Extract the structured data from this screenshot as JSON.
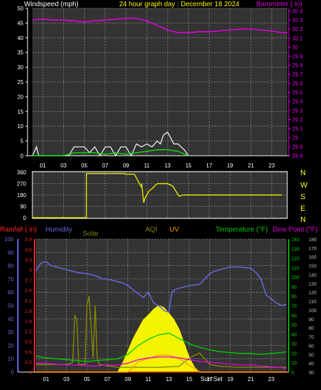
{
  "header": {
    "title": "24 hour graph day : December 18 2024",
    "left_label": "Windspeed (mph)",
    "right_label": "Barometer ( in)"
  },
  "colors": {
    "background": "#000000",
    "plot_background": "#333333",
    "grid": "#8a8a8a",
    "title": "#ffff00",
    "barometer": "#e000e0",
    "wind_gust": "#ffffff",
    "wind_avg": "#00ff00",
    "direction": "#e8e800",
    "rain": "#ff2222",
    "humidity": "#6666dd",
    "solar": "#808000",
    "solar_fill": "#ffff00",
    "aqi": "#888800",
    "uv": "#ff9900",
    "temperature": "#00cc00",
    "dewpoint": "#dd00dd"
  },
  "chart_data": [
    {
      "name": "wind-barometer",
      "type": "line",
      "xlabel": "",
      "x_ticks": [
        "01",
        "03",
        "05",
        "07",
        "09",
        "11",
        "13",
        "15",
        "17",
        "19",
        "21",
        "23"
      ],
      "xlim": [
        0,
        24.5
      ],
      "left_axis": {
        "label": "Windspeed (mph)",
        "ticks": [
          0,
          5,
          10,
          15,
          20,
          25,
          30,
          35,
          40,
          45,
          50
        ],
        "lim": [
          0,
          50
        ]
      },
      "right_axis": {
        "label": "Barometer ( in)",
        "ticks": [
          "28.8",
          "28.9",
          "29",
          "29.1",
          "29.2",
          "29.3",
          "29.4",
          "29.5",
          "29.6",
          "29.7",
          "29.8",
          "29.9",
          "30",
          "30.1",
          "30.2",
          "30.3",
          "30.4"
        ],
        "lim": [
          28.8,
          30.43
        ]
      },
      "series": [
        {
          "name": "Barometer",
          "axis": "right",
          "color": "#e000e0",
          "x": [
            0,
            1,
            2,
            3,
            4,
            5,
            6,
            7,
            8,
            9,
            10,
            11,
            12,
            13,
            14,
            15,
            16,
            17,
            18,
            19,
            20,
            21,
            22,
            23,
            24,
            24.5
          ],
          "y": [
            30.3,
            30.31,
            30.3,
            30.3,
            30.29,
            30.28,
            30.29,
            30.3,
            30.31,
            30.32,
            30.32,
            30.29,
            30.24,
            30.19,
            30.16,
            30.16,
            30.17,
            30.17,
            30.18,
            30.19,
            30.2,
            30.2,
            30.19,
            30.18,
            30.16,
            30.16
          ]
        },
        {
          "name": "Wind gust",
          "axis": "left",
          "color": "#ffffff",
          "x": [
            0,
            0.4,
            0.6,
            0.8,
            1.2,
            2,
            3,
            3.5,
            4,
            4.5,
            5,
            5.5,
            6,
            6.5,
            7,
            7.5,
            8,
            8.5,
            9,
            9.5,
            10,
            10.5,
            11,
            11.5,
            12,
            12.3,
            12.6,
            13,
            13.3,
            13.6,
            14,
            14.3,
            14.6,
            15
          ],
          "y": [
            0,
            3,
            0,
            0,
            0,
            0,
            0,
            0,
            3,
            3,
            3,
            1,
            3,
            0,
            3,
            3,
            0,
            3,
            3,
            0,
            4,
            3,
            4,
            3,
            5,
            4,
            7,
            8,
            6,
            4,
            4,
            3,
            2,
            0
          ]
        },
        {
          "name": "Wind avg",
          "axis": "left",
          "color": "#00ff00",
          "x": [
            0,
            1,
            2,
            3,
            4,
            5,
            6,
            7,
            8,
            9,
            10,
            11,
            12,
            13,
            14,
            15
          ],
          "y": [
            0,
            0,
            0,
            0,
            1,
            1,
            1,
            0.5,
            1,
            0.5,
            1,
            1.5,
            2,
            2,
            1.5,
            0
          ]
        }
      ]
    },
    {
      "name": "wind-direction",
      "type": "line",
      "left_axis": {
        "ticks": [
          0,
          90,
          180,
          270,
          360
        ],
        "lim": [
          0,
          360
        ]
      },
      "right_labels": [
        "N",
        "W",
        "S",
        "E",
        "N"
      ],
      "series": [
        {
          "name": "Wind direction",
          "color": "#e8e800",
          "x": [
            0,
            5.2,
            5.2,
            7,
            8,
            8.8,
            9,
            9.8,
            10.5,
            10.5,
            10.7,
            10.8,
            11.2,
            11.5,
            12,
            13,
            13.5,
            14.1,
            14.5,
            15,
            18,
            24
          ],
          "y": [
            0,
            0,
            350,
            350,
            350,
            350,
            345,
            345,
            240,
            270,
            120,
            150,
            210,
            230,
            270,
            270,
            250,
            170,
            180,
            180,
            180,
            180
          ]
        }
      ]
    },
    {
      "name": "weather-multi",
      "type": "line",
      "x_ticks": [
        "01",
        "03",
        "05",
        "07",
        "09",
        "11",
        "13",
        "15",
        "17",
        "19",
        "21",
        "23"
      ],
      "legend": {
        "rain": "Rainfall ( in)",
        "humidity": "Humidity",
        "solar": "Solar",
        "aqi": "AQI",
        "uv": "UV",
        "temperature": "Temperature (°F)",
        "dewpoint": "Dew Point (°F)"
      },
      "annotations": [
        "Sun Set"
      ],
      "humidity_axis": {
        "ticks": [
          0,
          10,
          20,
          30,
          40,
          50,
          60,
          70,
          80,
          90,
          100
        ],
        "lim": [
          0,
          100
        ]
      },
      "rain_axis": {
        "ticks": [
          "0",
          "0.3",
          "0.6",
          "0.9",
          "1.2",
          "1.5",
          "1.8",
          "2.1",
          "2.4",
          "2.7",
          "3",
          "3.3",
          "3.6",
          "3.9"
        ],
        "lim": [
          0,
          3.9
        ]
      },
      "solar_axis": {
        "ticks": [
          0,
          10,
          20,
          30,
          40,
          50,
          60,
          70,
          80,
          90,
          100,
          110,
          120,
          130,
          140
        ],
        "lim": [
          0,
          140
        ]
      },
      "temp_axis": {
        "ticks": [
          30,
          40,
          50,
          60,
          70,
          80,
          90,
          100,
          110,
          120,
          130,
          140,
          150,
          160,
          170,
          180
        ],
        "lim": [
          30,
          180
        ]
      },
      "series": [
        {
          "name": "Humidity",
          "color": "#6666dd",
          "x": [
            0,
            0.5,
            1,
            1.5,
            2,
            3,
            4,
            5,
            6,
            6.5,
            7,
            8,
            8.5,
            9,
            9.5,
            10,
            10.5,
            11,
            11.5,
            12,
            12.3,
            12.6,
            13,
            13.3,
            13.6,
            14,
            14.5,
            15,
            16,
            17,
            17.5,
            18,
            19,
            20,
            21,
            21.5,
            22,
            22.5,
            23,
            23.5,
            24,
            24.5
          ],
          "y": [
            76,
            82,
            83,
            80,
            79,
            77,
            75,
            74,
            72,
            70,
            70,
            68,
            67,
            65,
            62,
            59,
            56,
            60,
            52,
            50,
            48,
            46,
            45,
            60,
            62,
            63,
            64,
            65,
            66,
            74,
            76,
            77,
            79,
            79,
            78,
            75,
            70,
            58,
            55,
            52,
            50,
            51
          ]
        },
        {
          "name": "Temperature",
          "color": "#00cc00",
          "x": [
            0,
            1,
            2,
            3,
            4,
            5,
            6,
            7,
            8,
            9,
            10,
            11,
            12,
            13,
            14,
            15,
            16,
            17,
            18,
            19,
            20,
            21,
            22,
            23,
            24,
            24.5
          ],
          "y": [
            48,
            46,
            45,
            44,
            43,
            42,
            43,
            44,
            45,
            50,
            60,
            67,
            72,
            74,
            68,
            62,
            58,
            55,
            53,
            52,
            51,
            51,
            50,
            51,
            52,
            53
          ]
        },
        {
          "name": "Dew Point",
          "color": "#dd00dd",
          "x": [
            0,
            1,
            2,
            3,
            4,
            5,
            6,
            7,
            8,
            9,
            10,
            11,
            12,
            13,
            14,
            15,
            16,
            17,
            18,
            19,
            20,
            21,
            22,
            23,
            24,
            24.5
          ],
          "y": [
            40,
            40,
            39,
            38,
            38,
            37,
            37,
            38,
            38,
            40,
            44,
            46,
            47,
            47,
            46,
            44,
            42,
            41,
            40,
            39,
            38,
            38,
            37,
            36,
            35,
            34
          ]
        },
        {
          "name": "UV",
          "color": "#ff9900",
          "x": [
            0,
            8.5,
            9,
            10,
            11,
            12,
            13,
            14,
            15,
            16,
            24.5
          ],
          "y": [
            0,
            0,
            0,
            0.3,
            0.4,
            0.5,
            0.5,
            0.4,
            0.2,
            0,
            0
          ]
        },
        {
          "name": "Rainfall",
          "color": "#ff2222",
          "x": [
            0,
            24.5
          ],
          "y": [
            0,
            0
          ]
        },
        {
          "name": "Solar",
          "color": "#ffff00",
          "fill": true,
          "x": [
            8,
            8.5,
            9,
            9.5,
            10,
            10.5,
            11,
            11.5,
            12,
            12.5,
            13,
            13.5,
            14,
            14.5,
            15,
            15.5,
            16
          ],
          "y": [
            0,
            10,
            22,
            35,
            45,
            55,
            60,
            66,
            70,
            68,
            62,
            55,
            45,
            30,
            15,
            5,
            0
          ]
        },
        {
          "name": "AQI",
          "color": "#888800",
          "x": [
            0,
            3,
            3.6,
            3.8,
            4,
            4.2,
            4.8,
            5,
            5.2,
            5.6,
            5.8,
            6,
            6.2,
            8,
            12,
            14,
            15,
            16,
            17,
            18,
            20,
            24.5
          ],
          "y": [
            8,
            8,
            10,
            60,
            55,
            8,
            8,
            70,
            80,
            15,
            70,
            15,
            8,
            5,
            5,
            6,
            15,
            20,
            8,
            6,
            5,
            5
          ]
        }
      ]
    }
  ]
}
